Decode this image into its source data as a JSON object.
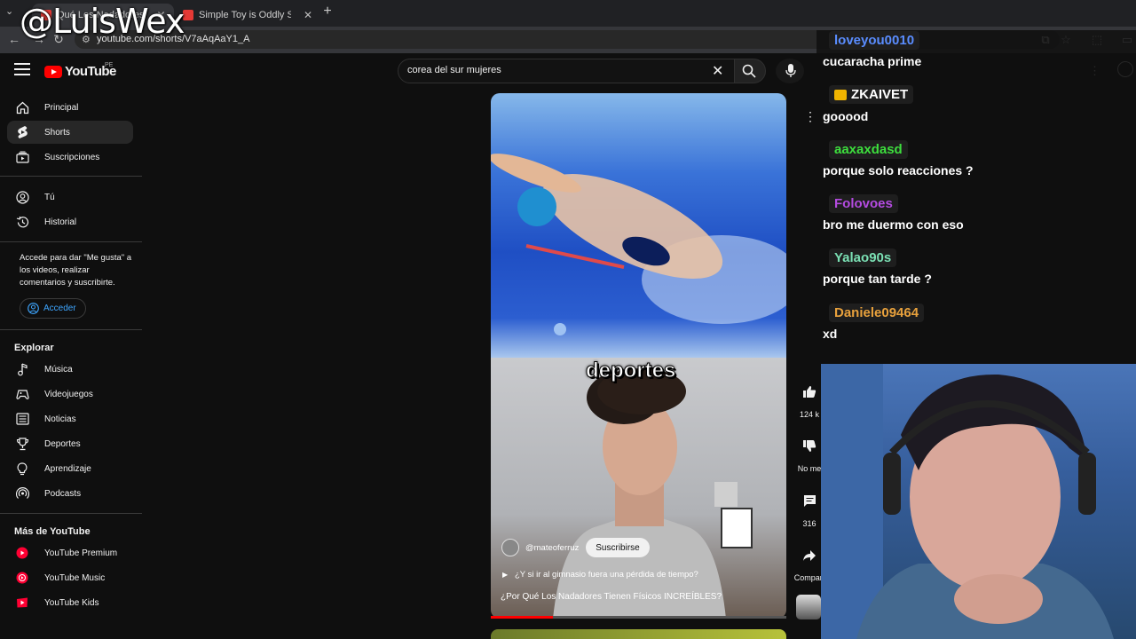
{
  "watermark": "@LuisWex",
  "browser": {
    "tabs": [
      {
        "title": "Qué Los Nadadores",
        "active": true
      },
      {
        "title": "Simple Toy is Oddly Satisfying!",
        "active": false
      }
    ],
    "url": "youtube.com/shorts/V7aAqAaY1_A"
  },
  "header": {
    "logo_text": "YouTube",
    "country": "PE",
    "search_query": "corea del sur mujeres"
  },
  "sidebar": {
    "main": [
      {
        "label": "Principal",
        "icon": "home-icon"
      },
      {
        "label": "Shorts",
        "icon": "shorts-icon",
        "active": true
      },
      {
        "label": "Suscripciones",
        "icon": "subscriptions-icon"
      }
    ],
    "you": [
      {
        "label": "Tú",
        "icon": "you-icon"
      },
      {
        "label": "Historial",
        "icon": "history-icon"
      }
    ],
    "signin_text": "Accede para dar \"Me gusta\" a los videos, realizar comentarios y suscribirte.",
    "signin_button": "Acceder",
    "explore_heading": "Explorar",
    "explore": [
      {
        "label": "Música",
        "icon": "music-icon"
      },
      {
        "label": "Videojuegos",
        "icon": "gaming-icon"
      },
      {
        "label": "Noticias",
        "icon": "news-icon"
      },
      {
        "label": "Deportes",
        "icon": "trophy-icon"
      },
      {
        "label": "Aprendizaje",
        "icon": "bulb-icon"
      },
      {
        "label": "Podcasts",
        "icon": "podcast-icon"
      }
    ],
    "more_heading": "Más de YouTube",
    "more": [
      {
        "label": "YouTube Premium"
      },
      {
        "label": "YouTube Music"
      },
      {
        "label": "YouTube Kids"
      }
    ]
  },
  "short": {
    "caption": "deportes",
    "channel": "@mateoferruz",
    "subscribe": "Suscribirse",
    "question": "¿Y si ir al gimnasio fuera una pérdida de tiempo?",
    "title": "¿Por Qué Los Nadadores Tienen Físicos INCREÍBLES?",
    "progress": 0.21
  },
  "actions": {
    "likes": "124 k",
    "dislike": "No me",
    "comments": "316",
    "share": "Compart"
  },
  "chat": [
    {
      "user": "loveyou0010",
      "color": "#5a8dff",
      "message": "cucaracha prime"
    },
    {
      "user": "ZKAIVET",
      "color": "#ffffff",
      "message": "gooood",
      "badge": "crown-icon"
    },
    {
      "user": "aaxaxdasd",
      "color": "#3dde3d",
      "message": "porque solo reacciones ?"
    },
    {
      "user": "Folovoes",
      "color": "#b44be0",
      "message": "bro me duermo con eso"
    },
    {
      "user": "Yalao90s",
      "color": "#7be0b4",
      "message": "porque tan tarde ?"
    },
    {
      "user": "Daniele09464",
      "color": "#e8a13c",
      "message": "xd"
    }
  ]
}
